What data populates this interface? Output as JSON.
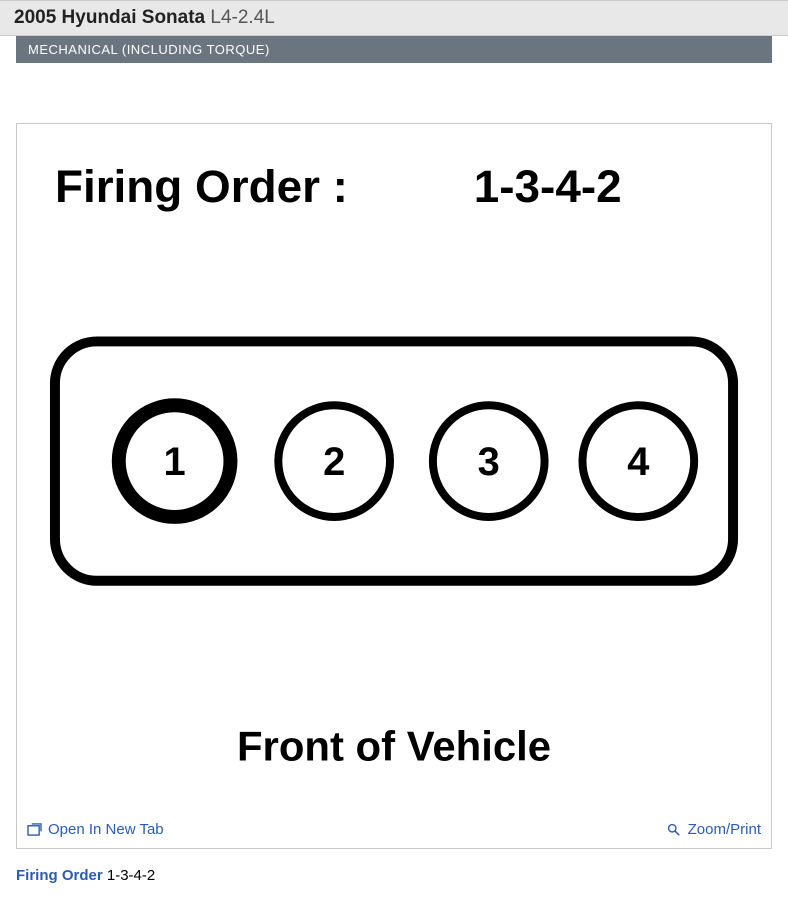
{
  "header": {
    "vehicle": "2005 Hyundai Sonata",
    "engine": "L4-2.4L"
  },
  "section_band": "MECHANICAL (INCLUDING TORQUE)",
  "diagram": {
    "title_label": "Firing Order :",
    "firing_order": "1-3-4-2",
    "cylinders": [
      "1",
      "2",
      "3",
      "4"
    ],
    "front_label": "Front of Vehicle"
  },
  "figure_actions": {
    "open_tab": "Open In New Tab",
    "zoom_print": "Zoom/Print"
  },
  "caption": {
    "label": "Firing Order",
    "value": "1-3-4-2"
  }
}
